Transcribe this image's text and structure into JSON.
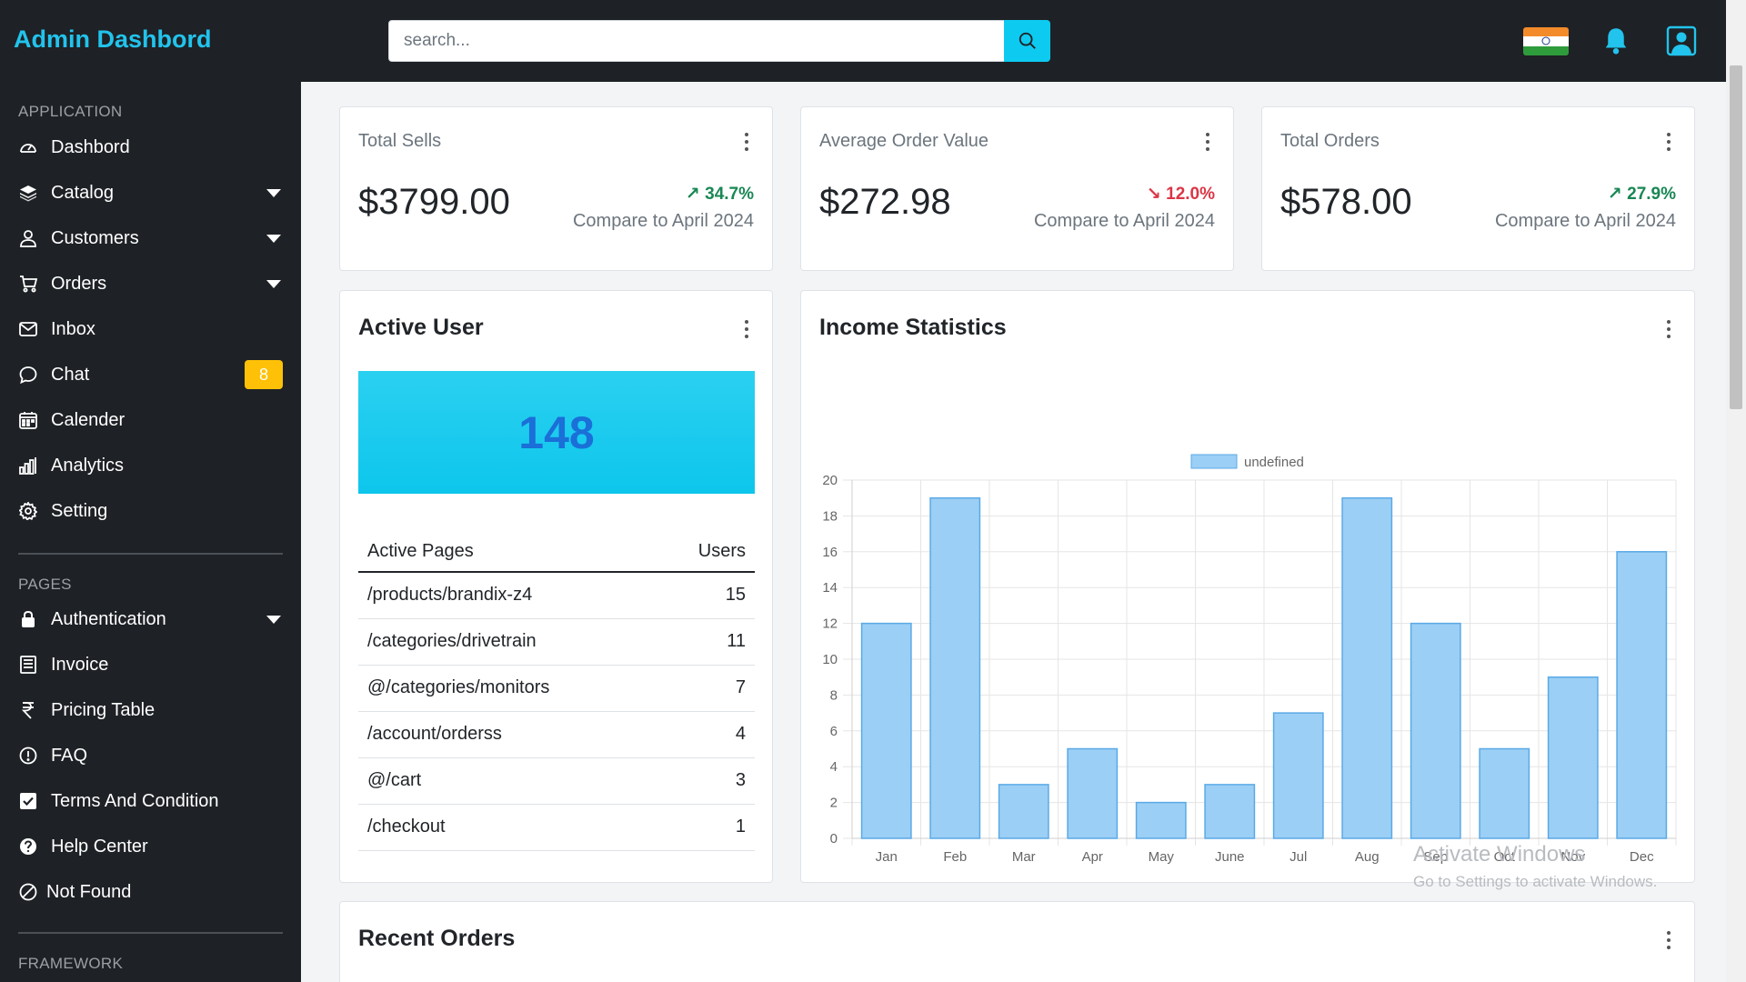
{
  "header": {
    "brand": "Admin Dashbord",
    "search_placeholder": "search..."
  },
  "sidebar": {
    "sections": [
      {
        "title": "APPLICATION"
      },
      {
        "title": "PAGES"
      },
      {
        "title": "FRAMEWORK"
      }
    ],
    "application_items": [
      {
        "label": "Dashbord",
        "icon": "dashboard-gauge-icon"
      },
      {
        "label": "Catalog",
        "icon": "layers-icon",
        "dropdown": true
      },
      {
        "label": "Customers",
        "icon": "person-icon",
        "dropdown": true
      },
      {
        "label": "Orders",
        "icon": "cart-icon",
        "dropdown": true
      },
      {
        "label": "Inbox",
        "icon": "envelope-icon"
      },
      {
        "label": "Chat",
        "icon": "chat-bubble-icon",
        "badge": "8"
      },
      {
        "label": "Calender",
        "icon": "calendar-icon"
      },
      {
        "label": "Analytics",
        "icon": "bar-chart-icon"
      },
      {
        "label": "Setting",
        "icon": "gear-icon"
      }
    ],
    "pages_items": [
      {
        "label": "Authentication",
        "icon": "lock-icon",
        "dropdown": true
      },
      {
        "label": "Invoice",
        "icon": "invoice-icon"
      },
      {
        "label": "Pricing Table",
        "icon": "rupee-icon"
      },
      {
        "label": "FAQ",
        "icon": "exclamation-circle-icon"
      },
      {
        "label": "Terms And Condition",
        "icon": "check-square-icon"
      },
      {
        "label": "Help Center",
        "icon": "question-circle-icon"
      },
      {
        "label": "Not Found",
        "icon": "slash-circle-icon"
      }
    ]
  },
  "stats": [
    {
      "title": "Total Sells",
      "value": "$3799.00",
      "change": "34.7%",
      "direction": "up",
      "compare": "Compare to April 2024"
    },
    {
      "title": "Average Order Value",
      "value": "$272.98",
      "change": "12.0%",
      "direction": "down",
      "compare": "Compare to April 2024"
    },
    {
      "title": "Total Orders",
      "value": "$578.00",
      "change": "27.9%",
      "direction": "up",
      "compare": "Compare to April 2024"
    }
  ],
  "active_user": {
    "title": "Active User",
    "count": "148",
    "columns": [
      "Active Pages",
      "Users"
    ],
    "rows": [
      {
        "page": "/products/brandix-z4",
        "users": "15"
      },
      {
        "page": "/categories/drivetrain",
        "users": "11"
      },
      {
        "page": "@/categories/monitors",
        "users": "7"
      },
      {
        "page": "/account/orderss",
        "users": "4"
      },
      {
        "page": "@/cart",
        "users": "3"
      },
      {
        "page": "/checkout",
        "users": "1"
      }
    ]
  },
  "income": {
    "title": "Income Statistics"
  },
  "recent_orders": {
    "title": "Recent Orders"
  },
  "watermark": {
    "line1": "Activate Windows",
    "line2": "Go to Settings to activate Windows."
  },
  "colors": {
    "accent": "#22c3ec",
    "sidebar_bg": "#1e2125",
    "bar_fill": "#9ccff5",
    "bar_stroke": "#5aa9e6",
    "up": "#198754",
    "down": "#dc3545",
    "badge": "#ffc107"
  },
  "chart_data": {
    "type": "bar",
    "categories": [
      "Jan",
      "Feb",
      "Mar",
      "Apr",
      "May",
      "June",
      "Jul",
      "Aug",
      "Sep",
      "Oct",
      "Nov",
      "Dec"
    ],
    "series": [
      {
        "name": "undefined",
        "values": [
          12,
          19,
          3,
          5,
          2,
          3,
          7,
          19,
          12,
          5,
          9,
          16
        ]
      }
    ],
    "yticks": [
      0,
      2,
      4,
      6,
      8,
      10,
      12,
      14,
      16,
      18,
      20
    ],
    "ylim": [
      0,
      20
    ],
    "grid": true,
    "legend": "top-center"
  }
}
